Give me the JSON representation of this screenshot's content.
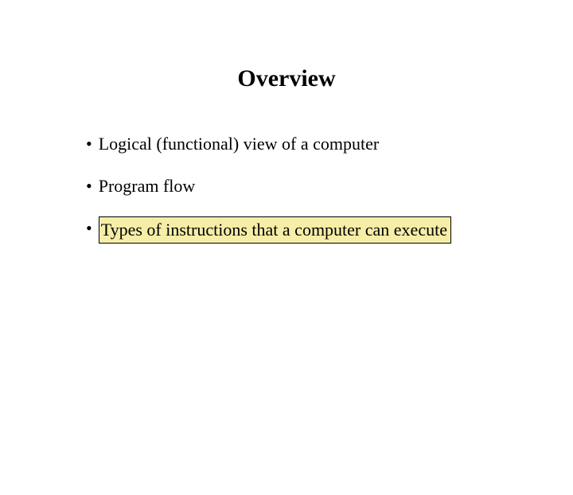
{
  "title": "Overview",
  "bullets": [
    {
      "text": "Logical (functional) view of a computer",
      "highlighted": false
    },
    {
      "text": "Program flow",
      "highlighted": false
    },
    {
      "text": "Types of instructions that a computer can execute",
      "highlighted": true
    }
  ]
}
